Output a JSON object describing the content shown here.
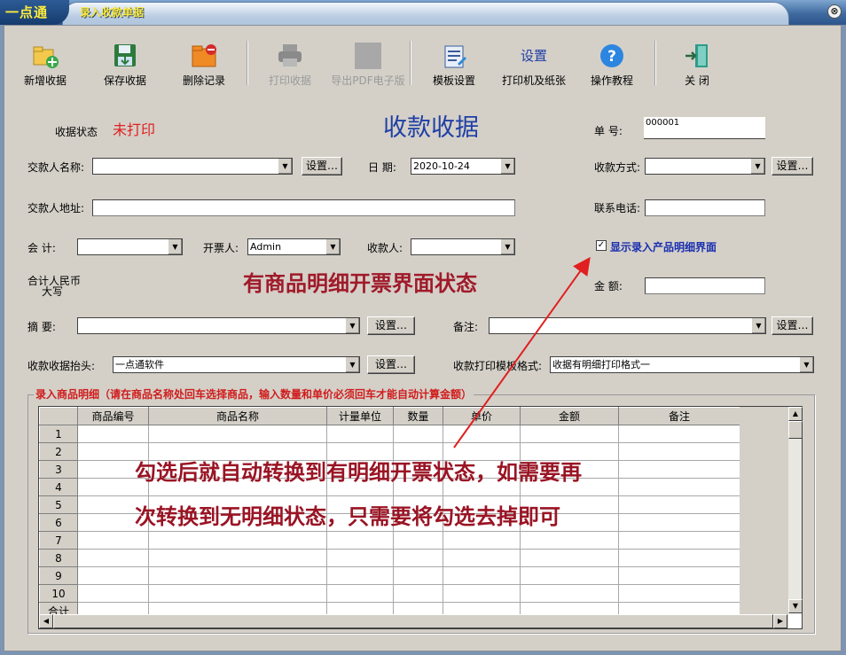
{
  "window": {
    "logo": "一点通",
    "title": "录入收款单据",
    "close": "⊗"
  },
  "toolbar": {
    "new": "新增收据",
    "save": "保存收据",
    "delete": "删除记录",
    "print": "打印收据",
    "export_pdf": "导出PDF电子版",
    "template": "模板设置",
    "printer_top": "设置",
    "printer": "打印机及纸张",
    "help": "操作教程",
    "close": "关 闭"
  },
  "form": {
    "status_label": "收据状态",
    "status_value": "未打印",
    "doc_title": "收款收据",
    "no_label": "单  号:",
    "no_value": "000001",
    "payer_label": "交款人名称:",
    "payer_value": "",
    "date_label": "日  期:",
    "date_value": "2020-10-24",
    "pay_method_label": "收款方式:",
    "pay_method_value": "",
    "payer_addr_label": "交款人地址:",
    "payer_addr_value": "",
    "phone_label": "联系电话:",
    "phone_value": "",
    "accountant_label": "会    计:",
    "accountant_value": "",
    "issuer_label": "开票人:",
    "issuer_value": "Admin",
    "receiver_label": "收款人:",
    "receiver_value": "",
    "show_detail_label": "显示录入产品明细界面",
    "show_detail_checked": "✓",
    "total_rmb_label_1": "合计人民币",
    "total_rmb_label_2": "大写",
    "amount_label": "金  额:",
    "amount_value": "",
    "summary_label": "摘    要:",
    "summary_value": "",
    "remark_label": "备注:",
    "remark_value": "",
    "header_label": "收款收据抬头:",
    "header_value": "一点通软件",
    "template_label": "收款打印模板格式:",
    "template_value": "收据有明细打印格式一",
    "setting_button": "设置…"
  },
  "annotations": {
    "a1": "有商品明细开票界面状态",
    "a2": "勾选后就自动转换到有明细开票状态，如需要再",
    "a3": "次转换到无明细状态，只需要将勾选去掉即可"
  },
  "detail": {
    "group_title": "录入商品明细（请在商品名称处回车选择商品，输入数量和单价必须回车才能自动计算金额）",
    "columns": [
      "",
      "商品编号",
      "商品名称",
      "计量单位",
      "数量",
      "单价",
      "金额",
      "备注"
    ],
    "rows": [
      "1",
      "2",
      "3",
      "4",
      "5",
      "6",
      "7",
      "8",
      "9",
      "10"
    ],
    "total_label": "合计"
  },
  "colors": {
    "title_blue": "#1f3fa6",
    "status_red": "#e02020",
    "annotation": "#a01a2a",
    "arrow": "#e02020"
  }
}
